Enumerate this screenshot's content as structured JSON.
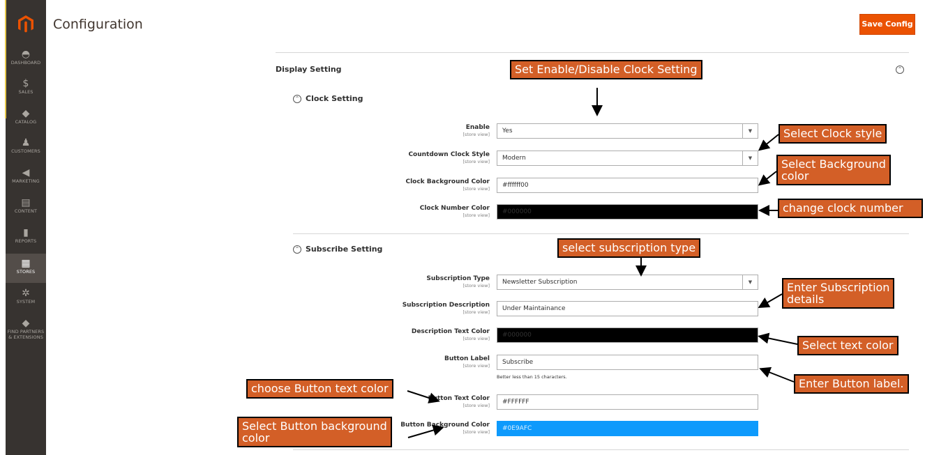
{
  "header": {
    "title": "Configuration",
    "save_label": "Save Config"
  },
  "sidebar": {
    "items": [
      {
        "label": "DASHBOARD",
        "icon": "dashboard-icon"
      },
      {
        "label": "SALES",
        "icon": "dollar-icon"
      },
      {
        "label": "CATALOG",
        "icon": "box-icon"
      },
      {
        "label": "CUSTOMERS",
        "icon": "person-icon"
      },
      {
        "label": "MARKETING",
        "icon": "megaphone-icon"
      },
      {
        "label": "CONTENT",
        "icon": "layout-icon"
      },
      {
        "label": "REPORTS",
        "icon": "bar-chart-icon"
      },
      {
        "label": "STORES",
        "icon": "store-icon"
      },
      {
        "label": "SYSTEM",
        "icon": "gear-icon"
      },
      {
        "label_line1": "FIND PARTNERS",
        "label_line2": "& EXTENSIONS",
        "icon": "box-icon"
      }
    ]
  },
  "display_setting": {
    "title": "Display Setting",
    "clock": {
      "title": "Clock Setting",
      "fields": {
        "enable": {
          "label": "Enable",
          "scope": "[store view]",
          "value": "Yes"
        },
        "style": {
          "label": "Countdown Clock Style",
          "scope": "[store view]",
          "value": "Modern"
        },
        "bg_color": {
          "label": "Clock Background Color",
          "scope": "[store view]",
          "value": "#ffffff00"
        },
        "number_color": {
          "label": "Clock Number Color",
          "scope": "[store view]",
          "value": "#000000",
          "swatch": "#000000"
        }
      }
    },
    "subscribe": {
      "title": "Subscribe Setting",
      "fields": {
        "type": {
          "label": "Subscription Type",
          "scope": "[store view]",
          "value": "Newsletter Subscription"
        },
        "description": {
          "label": "Subscription Description",
          "scope": "[store view]",
          "value": "Under Maintainance"
        },
        "desc_color": {
          "label": "Description Text Color",
          "scope": "[store view]",
          "value": "#000000",
          "swatch": "#000000"
        },
        "button_label": {
          "label": "Button Label",
          "scope": "[store view]",
          "value": "Subscribe",
          "note": "Better less than 15 characters."
        },
        "button_text_color": {
          "label": "Button Text Color",
          "scope": "[store view]",
          "value": "#FFFFFF"
        },
        "button_bg_color": {
          "label": "Button Background Color",
          "scope": "[store view]",
          "value": "#0E9AFC",
          "swatch": "#0E9AFC"
        }
      }
    }
  },
  "annotations": {
    "enable_clock": "Set Enable/Disable Clock Setting",
    "clock_style": "Select Clock style",
    "bg_color_line1": "Select Background",
    "bg_color_line2": "color",
    "clock_number": "change clock number",
    "subscription_type": "select subscription type",
    "sub_details_line1": "Enter Subscription",
    "sub_details_line2": " details",
    "text_color": "Select text color",
    "button_label": "Enter Button label.",
    "button_text_color": "choose Button text color",
    "button_bg_line1": "Select Button background",
    "button_bg_line2": "color"
  },
  "colors": {
    "accent": "#eb5202",
    "sidebar": "#373330",
    "callout": "#d35f27"
  }
}
